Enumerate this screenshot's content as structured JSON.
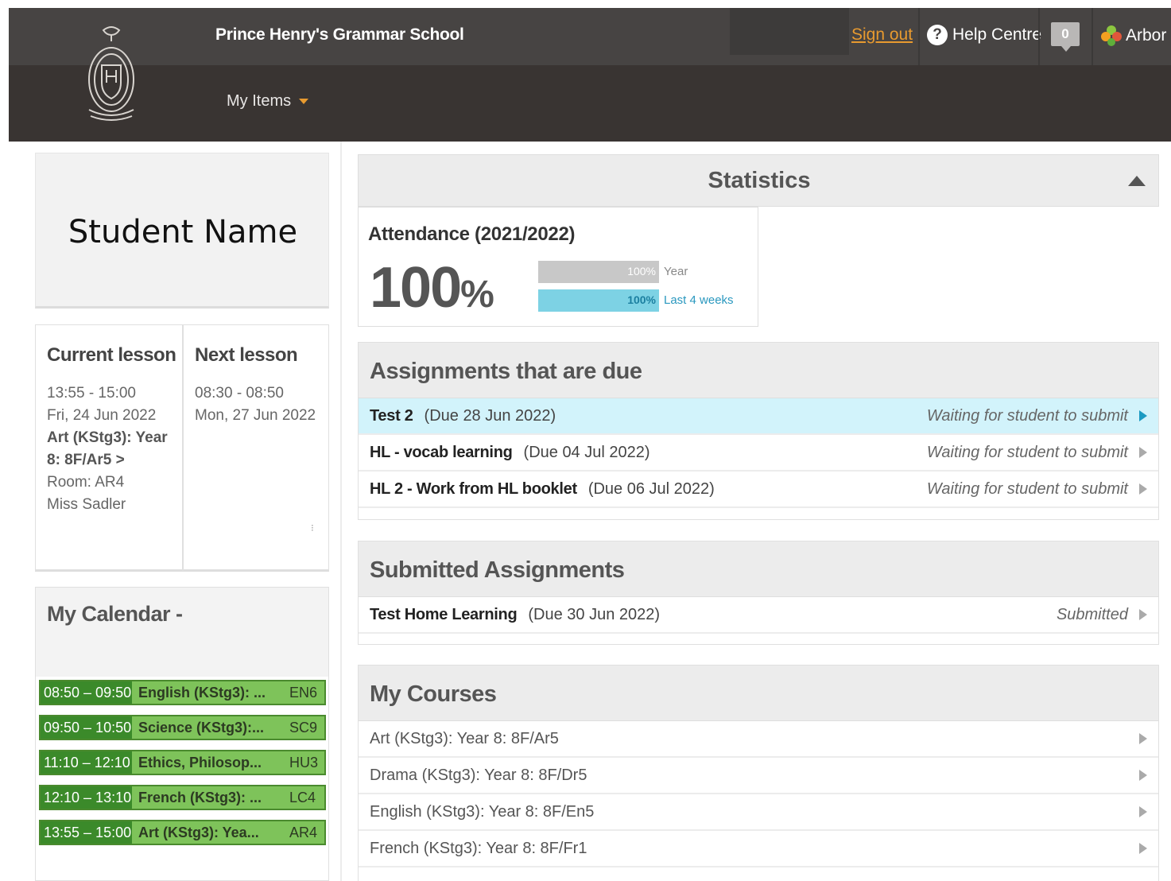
{
  "header": {
    "school_name": "Prince Henry's Grammar School",
    "signout_label": "Sign out",
    "help_label": "Help Centre",
    "notification_count": "0",
    "brand_label": "Arbor",
    "menu_label": "My Items"
  },
  "student": {
    "name": "Student Name"
  },
  "current_lesson": {
    "title": "Current lesson",
    "time": "13:55 - 15:00",
    "date": "Fri, 24 Jun 2022",
    "course_line1": "Art (KStg3): Year",
    "course_line2": "8: 8F/Ar5 >",
    "room": "Room: AR4",
    "teacher": "Miss Sadler"
  },
  "next_lesson": {
    "title": "Next lesson",
    "time": "08:30 - 08:50",
    "date": "Mon, 27 Jun 2022"
  },
  "calendar": {
    "title": "My Calendar -",
    "items": [
      {
        "time": "08:50 – 09:50",
        "subject": "English (KStg3): ...",
        "room": "EN6"
      },
      {
        "time": "09:50 – 10:50",
        "subject": "Science (KStg3):...",
        "room": "SC9"
      },
      {
        "time": "11:10 – 12:10",
        "subject": "Ethics, Philosop...",
        "room": "HU3"
      },
      {
        "time": "12:10 – 13:10",
        "subject": "French (KStg3): ...",
        "room": "LC4"
      },
      {
        "time": "13:55 – 15:00",
        "subject": "Art (KStg3): Yea...",
        "room": "AR4"
      }
    ]
  },
  "statistics": {
    "title": "Statistics",
    "attendance_title": "Attendance (2021/2022)",
    "attendance_value": "100",
    "attendance_unit": "%",
    "year_percent": 100,
    "year_label": "100%",
    "year_caption": "Year",
    "recent_percent": 100,
    "recent_label": "100%",
    "recent_caption": "Last 4 weeks"
  },
  "assignments_due": {
    "title": "Assignments that are due",
    "rows": [
      {
        "name": "Test 2",
        "due": "(Due 28 Jun 2022)",
        "status": "Waiting for student to submit"
      },
      {
        "name": "HL - vocab learning",
        "due": "(Due 04 Jul 2022)",
        "status": "Waiting for student to submit"
      },
      {
        "name": "HL 2 - Work from HL booklet",
        "due": "(Due 06 Jul 2022)",
        "status": "Waiting for student to submit"
      }
    ]
  },
  "submitted": {
    "title": "Submitted Assignments",
    "rows": [
      {
        "name": "Test Home Learning",
        "due": "(Due 30 Jun 2022)",
        "status": "Submitted"
      }
    ]
  },
  "courses": {
    "title": "My Courses",
    "rows": [
      "Art (KStg3): Year 8: 8F/Ar5",
      "Drama (KStg3): Year 8: 8F/Dr5",
      "English (KStg3): Year 8: 8F/En5",
      "French (KStg3): Year 8: 8F/Fr1"
    ]
  },
  "colors": {
    "header_bg": "#474443",
    "subheader_bg": "#393432",
    "link_orange": "#e89a2f",
    "calendar_green": "#7ec35a",
    "calendar_dark_green": "#3b8a2a",
    "highlight_blue": "#d2f3fb",
    "bar_blue": "#7dd2e4"
  }
}
